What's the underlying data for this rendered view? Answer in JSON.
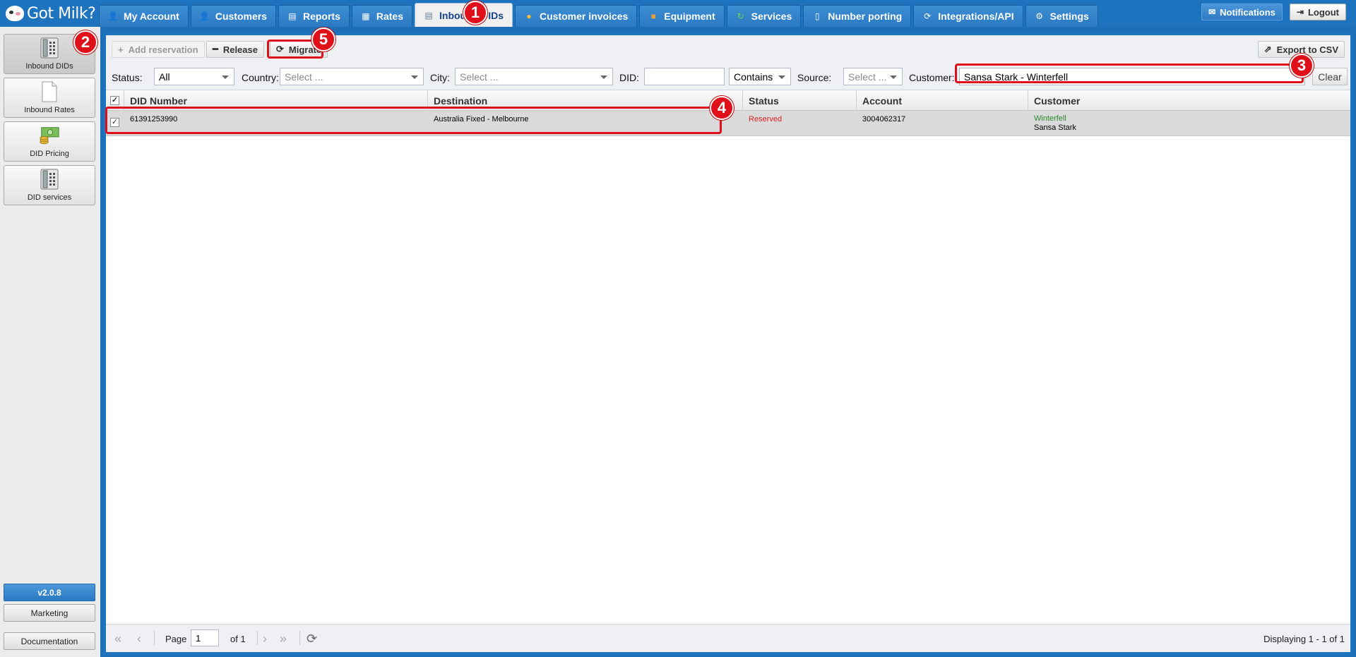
{
  "app": {
    "logo_text": "Got Milk?"
  },
  "tabs": [
    {
      "label": "My Account",
      "icon": "user-icon"
    },
    {
      "label": "Customers",
      "icon": "customers-icon"
    },
    {
      "label": "Reports",
      "icon": "reports-icon"
    },
    {
      "label": "Rates",
      "icon": "rates-icon"
    },
    {
      "label": "Inbound DIDs",
      "icon": "inbound-dids-icon",
      "active": true
    },
    {
      "label": "Customer invoices",
      "icon": "invoice-icon"
    },
    {
      "label": "Equipment",
      "icon": "equipment-icon"
    },
    {
      "label": "Services",
      "icon": "services-icon"
    },
    {
      "label": "Number porting",
      "icon": "porting-icon"
    },
    {
      "label": "Integrations/API",
      "icon": "integrations-icon"
    },
    {
      "label": "Settings",
      "icon": "settings-icon"
    }
  ],
  "top_right": {
    "notifications": "Notifications",
    "logout": "Logout"
  },
  "sidebar": {
    "items": [
      {
        "label": "Inbound DIDs",
        "icon": "phone-icon",
        "active": true
      },
      {
        "label": "Inbound Rates",
        "icon": "document-icon"
      },
      {
        "label": "DID Pricing",
        "icon": "money-icon"
      },
      {
        "label": "DID services",
        "icon": "phone-icon"
      }
    ],
    "version": "v2.0.8",
    "marketing": "Marketing",
    "documentation": "Documentation"
  },
  "toolbar": {
    "add_reservation": "Add reservation",
    "release": "Release",
    "migrate": "Migrate",
    "export_csv": "Export to CSV"
  },
  "filters": {
    "status_label": "Status:",
    "status_value": "All",
    "country_label": "Country:",
    "country_placeholder": "Select ...",
    "city_label": "City:",
    "city_placeholder": "Select ...",
    "did_label": "DID:",
    "did_value": "",
    "match_value": "Contains",
    "source_label": "Source:",
    "source_placeholder": "Select ...",
    "customer_label": "Customer:",
    "customer_value": "Sansa Stark - Winterfell",
    "clear": "Clear"
  },
  "grid": {
    "columns": [
      "DID Number",
      "Destination",
      "Status",
      "Account",
      "Customer"
    ],
    "rows": [
      {
        "did_number": "61391253990",
        "destination": "Australia Fixed - Melbourne",
        "status": "Reserved",
        "account": "3004062317",
        "customer_company": "Winterfell",
        "customer_name": "Sansa Stark",
        "checked": true
      }
    ]
  },
  "pager": {
    "page_label": "Page",
    "page_value": "1",
    "of_label": "of 1",
    "displaying": "Displaying 1 - 1 of 1"
  },
  "callouts": [
    "1",
    "2",
    "3",
    "4",
    "5"
  ],
  "colors": {
    "primary": "#1e73be",
    "callout": "#e0101a",
    "status_reserved": "#e02020",
    "customer_company": "#2a8a2a"
  }
}
